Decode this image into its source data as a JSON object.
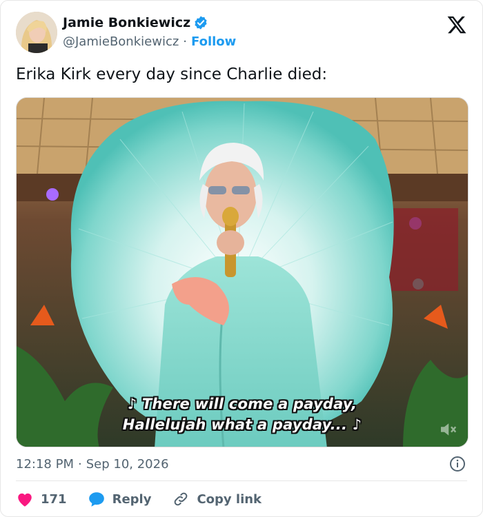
{
  "author": {
    "display_name": "Jamie Bonkiewicz",
    "handle": "@JamieBonkiewicz",
    "separator": "·",
    "follow_label": "Follow",
    "verified": true
  },
  "tweet": {
    "text": "Erika Kirk every day since Charlie died:"
  },
  "media": {
    "caption_line1": "♪ There will come a payday,",
    "caption_line2": "Hallelujah what a payday... ♪"
  },
  "meta": {
    "time": "12:18 PM",
    "separator": "·",
    "date": "Sep 10, 2026"
  },
  "actions": {
    "like_count": "171",
    "reply_label": "Reply",
    "copy_label": "Copy link"
  },
  "colors": {
    "accent": "#1d9bf0",
    "like": "#f91880",
    "text": "#0f1419",
    "muted": "#536471"
  },
  "icons": [
    "verified-badge-icon",
    "x-logo-icon",
    "info-icon",
    "heart-icon",
    "reply-bubble-icon",
    "link-icon",
    "mute-icon"
  ]
}
